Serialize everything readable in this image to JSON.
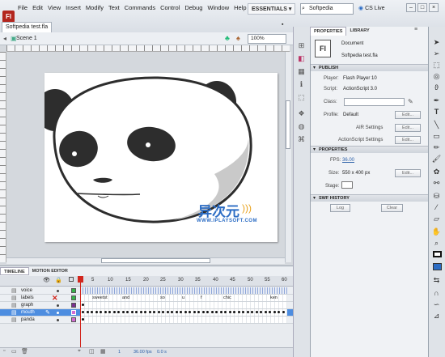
{
  "app": {
    "logo": "Fl"
  },
  "menu": [
    "File",
    "Edit",
    "View",
    "Insert",
    "Modify",
    "Text",
    "Commands",
    "Control",
    "Debug",
    "Window",
    "Help"
  ],
  "topbar": {
    "workspace": "ESSENTIALS ▾",
    "search_value": "Softpedia",
    "cslive": "CS Live",
    "win_buttons": [
      "–",
      "□",
      "×"
    ]
  },
  "document": {
    "tab": "Softpedia test.fla",
    "scene": "Scene 1",
    "zoom": "100%"
  },
  "watermark": {
    "title": "异次元",
    "url": "WWW.IPLAYSOFT.COM"
  },
  "timeline": {
    "tabs": [
      "TIMELINE",
      "MOTION EDITOR"
    ],
    "frame_numbers": [
      "5",
      "10",
      "15",
      "20",
      "25",
      "30",
      "35",
      "40",
      "45",
      "50",
      "55",
      "60"
    ],
    "layers": [
      {
        "name": "voice"
      },
      {
        "name": "labels"
      },
      {
        "name": "graph"
      },
      {
        "name": "mouth"
      },
      {
        "name": "panda"
      }
    ],
    "frame_labels": [
      "sweetst",
      "and",
      "so",
      "u",
      "f",
      "chic",
      "ken"
    ],
    "footer": {
      "frame": "1",
      "fps": "36.00 fps",
      "time": "0.0 s"
    }
  },
  "properties": {
    "tabs": [
      "PROPERTIES",
      "LIBRARY"
    ],
    "doc_type": "Document",
    "doc_name": "Softpedia test.fla",
    "publish": {
      "header": "PUBLISH",
      "player_label": "Player:",
      "player_value": "Flash Player 10",
      "script_label": "Script:",
      "script_value": "ActionScript 3.0",
      "class_label": "Class:",
      "profile_label": "Profile:",
      "profile_value": "Default",
      "edit": "Edit...",
      "air_label": "AIR Settings",
      "as_label": "ActionScript Settings"
    },
    "props": {
      "header": "PROPERTIES",
      "fps_label": "FPS:",
      "fps_value": "36.00",
      "size_label": "Size:",
      "size_value": "550 x 400 px",
      "stage_label": "Stage:",
      "edit": "Edit..."
    },
    "history": {
      "header": "SWF HISTORY",
      "log": "Log",
      "clear": "Clear"
    }
  },
  "colors": {
    "accent": "#2b6cc4",
    "playhead": "#d2261d",
    "selected_row": "#4d8de0"
  }
}
